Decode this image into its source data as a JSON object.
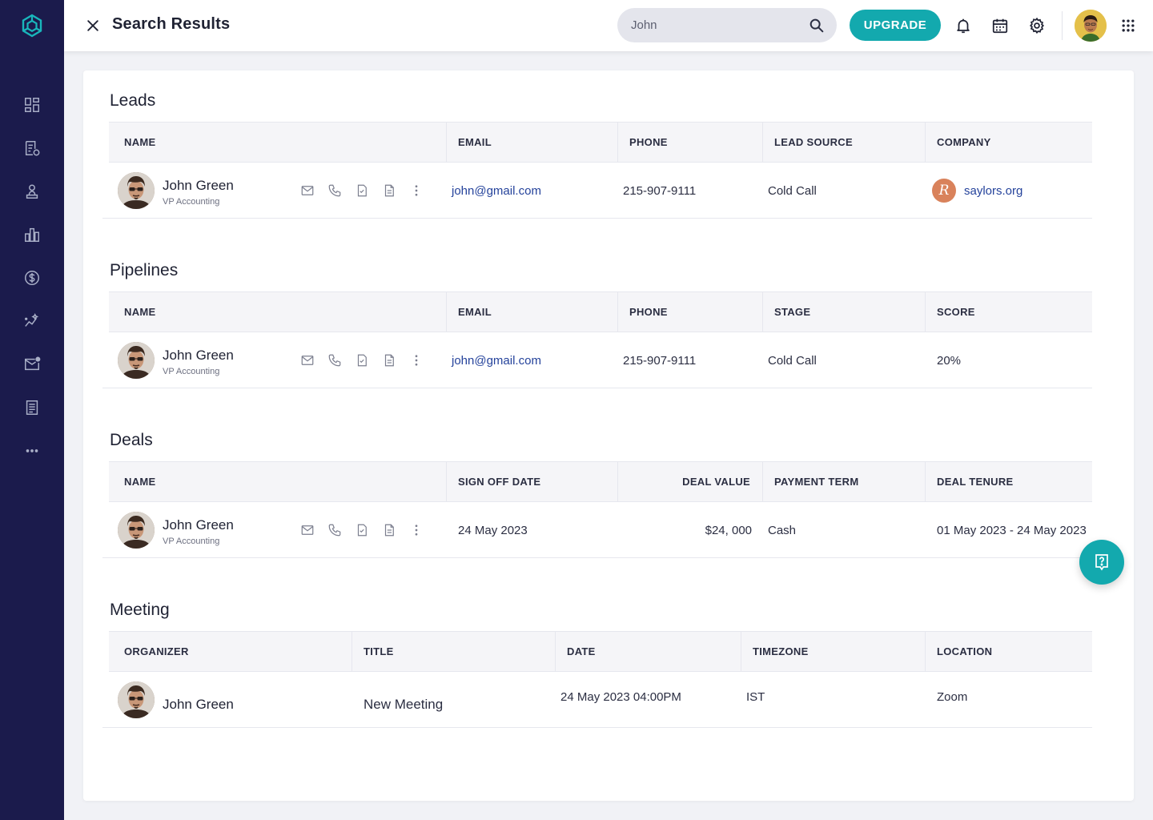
{
  "header": {
    "title": "Search Results",
    "search_value": "John",
    "upgrade_label": "UPGRADE",
    "icons": [
      "close-icon",
      "search-icon",
      "bell-icon",
      "calendar-icon",
      "gear-icon",
      "apps-grid-icon"
    ]
  },
  "sidebar": {
    "items": [
      {
        "name": "dashboard-icon"
      },
      {
        "name": "leads-icon"
      },
      {
        "name": "contacts-icon"
      },
      {
        "name": "reports-icon"
      },
      {
        "name": "deals-icon"
      },
      {
        "name": "analytics-icon"
      },
      {
        "name": "mail-icon"
      },
      {
        "name": "notes-icon"
      },
      {
        "name": "more-icon"
      }
    ]
  },
  "colors": {
    "sidebar_bg": "#1b1b4c",
    "accent": "#13a9ae",
    "link": "#24429b"
  },
  "leads": {
    "title": "Leads",
    "columns": [
      "NAME",
      "EMAIL",
      "PHONE",
      "LEAD SOURCE",
      "COMPANY"
    ],
    "row": {
      "name": "John Green",
      "subtitle": "VP Accounting",
      "email": "john@gmail.com",
      "phone": "215-907-9111",
      "lead_source": "Cold Call",
      "company": "saylors.org"
    }
  },
  "pipelines": {
    "title": "Pipelines",
    "columns": [
      "NAME",
      "EMAIL",
      "PHONE",
      "STAGE",
      "SCORE"
    ],
    "row": {
      "name": "John Green",
      "subtitle": "VP Accounting",
      "email": "john@gmail.com",
      "phone": "215-907-9111",
      "stage": "Cold Call",
      "score": "20%"
    }
  },
  "deals": {
    "title": "Deals",
    "columns": [
      "NAME",
      "SIGN OFF DATE",
      "DEAL VALUE",
      "PAYMENT TERM",
      "DEAL TENURE"
    ],
    "row": {
      "name": "John Green",
      "subtitle": "VP Accounting",
      "sign_off_date": "24 May 2023",
      "deal_value": "$24, 000",
      "payment_term": "Cash",
      "deal_tenure": "01 May 2023 - 24 May 2023"
    }
  },
  "meeting": {
    "title": "Meeting",
    "columns": [
      "ORGANIZER",
      "TITLE",
      "DATE",
      "TIMEZONE",
      "LOCATION"
    ],
    "row": {
      "organizer": "John Green",
      "title": "New Meeting",
      "date": "24 May 2023 04:00PM",
      "timezone": "IST",
      "location": "Zoom"
    }
  }
}
